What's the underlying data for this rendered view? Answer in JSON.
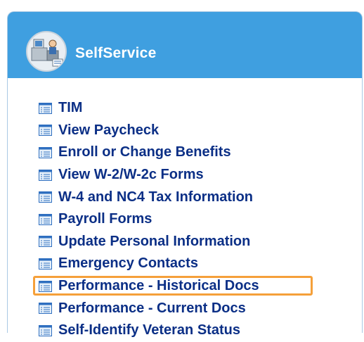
{
  "panel": {
    "title": "SelfService",
    "header_icon": "selfservice-office-icon",
    "colors": {
      "header_bg": "#3f9fe0",
      "link_text": "#0b2f86",
      "highlight_border": "#f5a03a",
      "panel_border": "#a9c9e4"
    }
  },
  "menu": {
    "item_icon": "list-document-icon",
    "items": [
      {
        "label": "TIM"
      },
      {
        "label": "View Paycheck"
      },
      {
        "label": "Enroll or Change Benefits"
      },
      {
        "label": "View W-2/W-2c Forms"
      },
      {
        "label": "W-4 and NC4 Tax Information"
      },
      {
        "label": "Payroll Forms"
      },
      {
        "label": "Update Personal Information"
      },
      {
        "label": "Emergency Contacts"
      },
      {
        "label": "Performance - Historical Docs",
        "highlighted": true
      },
      {
        "label": "Performance - Current Docs"
      },
      {
        "label": "Self-Identify Veteran Status"
      }
    ]
  }
}
